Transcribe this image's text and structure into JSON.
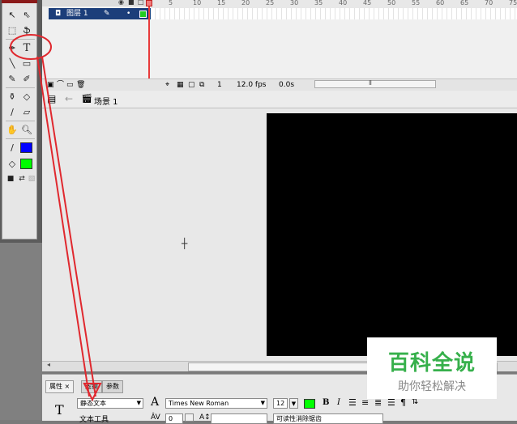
{
  "timeline": {
    "layer_name": "图层 1",
    "ruler_ticks": [
      "5",
      "10",
      "15",
      "20",
      "25",
      "30",
      "35",
      "40",
      "45",
      "50",
      "55",
      "60",
      "65",
      "70",
      "75"
    ],
    "status": {
      "current_frame": "1",
      "fps": "12.0 fps",
      "time": "0.0s"
    }
  },
  "scene": {
    "name": "场景 1"
  },
  "properties": {
    "tabs": [
      "属性 ×",
      "滤镜",
      "参数"
    ],
    "text_type": "静态文本",
    "tool_name": "文本工具",
    "font": "Times New Roman",
    "font_size": "12",
    "letter_spacing": "0",
    "anti_alias": "可读性消除锯齿",
    "bold_label": "B",
    "italic_label": "I",
    "font_glyph": "A",
    "text_tool_glyph": "T"
  },
  "colors": {
    "stage_background": "#000000",
    "text_color": "#00ff00",
    "stroke_color_swatch": "#0000ff",
    "fill_color_swatch": "#00ff00",
    "annotation": "#e0282e",
    "watermark_green": "#36b04b"
  },
  "watermark": {
    "title": "百科全说",
    "subtitle": "助你轻松解决"
  },
  "toolbox": {
    "tools": [
      "selection-tool",
      "subselection-tool",
      "free-transform-tool",
      "lasso-tool",
      "pen-tool",
      "text-tool",
      "line-tool",
      "rectangle-tool",
      "pencil-tool",
      "brush-tool",
      "ink-bottle-tool",
      "paint-bucket-tool",
      "eyedropper-tool",
      "eraser-tool",
      "hand-tool",
      "zoom-tool",
      "stroke-color",
      "fill-color"
    ],
    "text_tool_label": "T"
  }
}
